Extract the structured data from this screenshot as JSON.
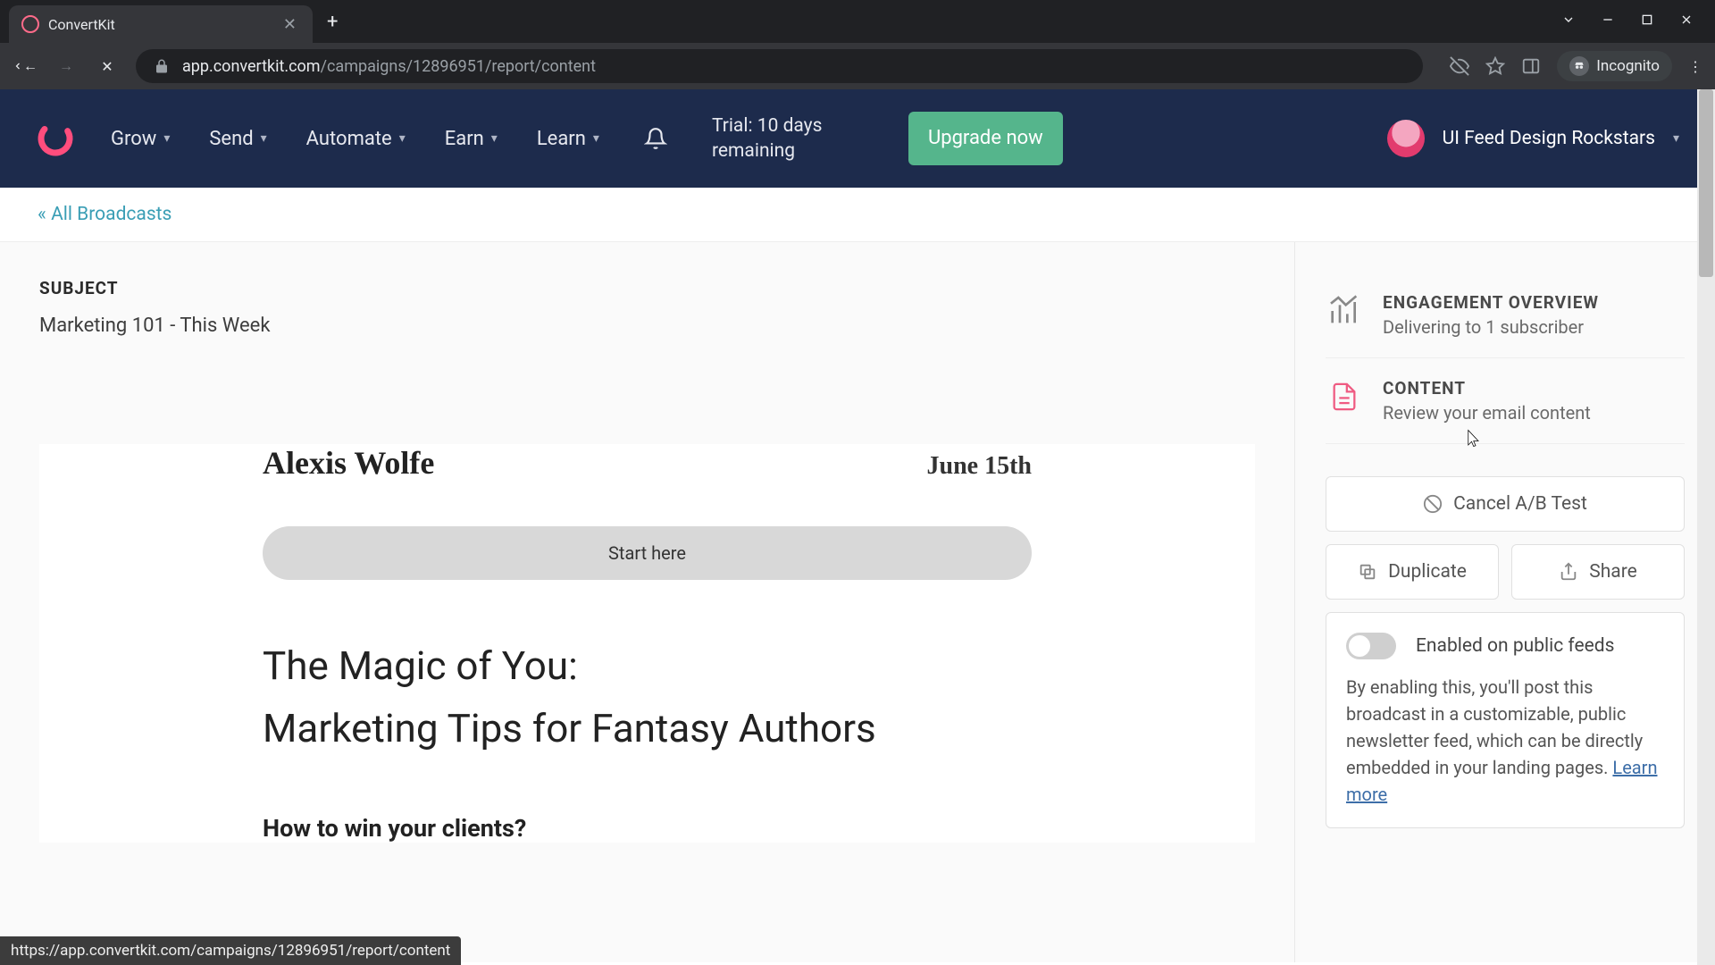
{
  "browser": {
    "tab_title": "ConvertKit",
    "url_display_domain": "app.convertkit.com",
    "url_display_path": "/campaigns/12896951/report/content",
    "incognito_label": "Incognito"
  },
  "header": {
    "nav": {
      "grow": "Grow",
      "send": "Send",
      "automate": "Automate",
      "earn": "Earn",
      "learn": "Learn"
    },
    "trial_text": "Trial: 10 days remaining",
    "upgrade_label": "Upgrade now",
    "account_name": "UI Feed Design Rockstars"
  },
  "subheader": {
    "back_link": "« All Broadcasts"
  },
  "subject": {
    "label": "SUBJECT",
    "value": "Marketing 101 - This Week"
  },
  "preview": {
    "author": "Alexis Wolfe",
    "date": "June 15th",
    "cta": "Start here",
    "headline1": "The Magic of You:",
    "headline2": "Marketing Tips for Fantasy Authors",
    "subhead": "How to win your clients?"
  },
  "sidebar": {
    "engagement": {
      "title": "ENGAGEMENT OVERVIEW",
      "sub": "Delivering to 1 subscriber"
    },
    "content": {
      "title": "CONTENT",
      "sub": "Review your email content"
    },
    "cancel_ab": "Cancel A/B Test",
    "duplicate": "Duplicate",
    "share": "Share",
    "public_feeds": {
      "label": "Enabled on public feeds",
      "desc": "By enabling this, you'll post this broadcast in a customizable, public newsletter feed, which can be directly embedded in your landing pages. ",
      "learn_more": "Learn more"
    }
  },
  "status_url": "https://app.convertkit.com/campaigns/12896951/report/content"
}
